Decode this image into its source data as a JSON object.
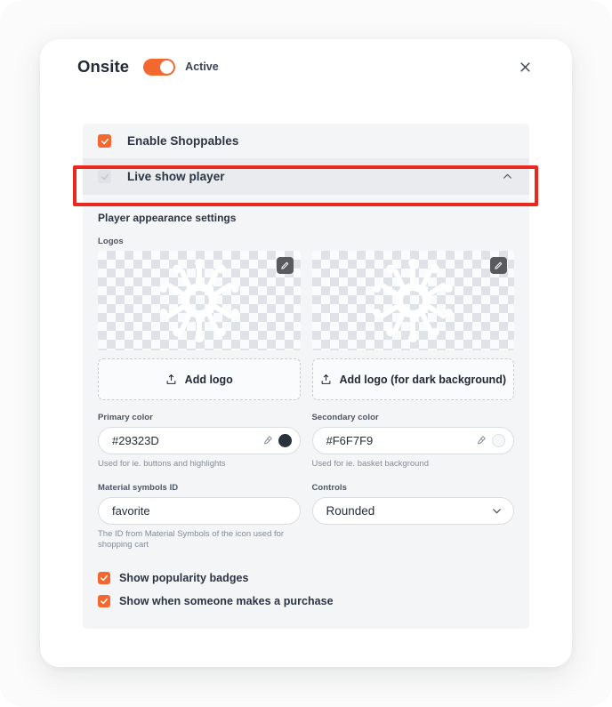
{
  "header": {
    "title": "Onsite",
    "toggle_state_label": "Active",
    "toggle_on": true,
    "close_icon": "close-icon"
  },
  "panel": {
    "rows": [
      {
        "label": "Enable Shoppables",
        "checked": true,
        "state": "on"
      },
      {
        "label": "Live show player",
        "checked": true,
        "state": "off",
        "expanded": true,
        "chevron_icon": "chevron-up-icon"
      }
    ],
    "section_title": "Player appearance settings",
    "logos_label": "Logos",
    "logos": [
      {
        "edit_icon": "pencil-icon",
        "alt": "starburst-logo"
      },
      {
        "edit_icon": "pencil-icon",
        "alt": "starburst-logo-dark"
      }
    ],
    "add_logo_buttons": [
      {
        "label": "Add logo",
        "icon": "upload-icon"
      },
      {
        "label": "Add logo (for dark background)",
        "icon": "upload-icon"
      }
    ],
    "fields": {
      "primary_color": {
        "label": "Primary color",
        "value": "#29323D",
        "help": "Used for ie. buttons and highlights",
        "swatch_hex": "#29323D",
        "picker_icon": "eyedropper-icon"
      },
      "secondary_color": {
        "label": "Secondary color",
        "value": "#F6F7F9",
        "help": "Used for ie. basket background",
        "swatch_hex": "#F6F7F9",
        "picker_icon": "eyedropper-icon"
      },
      "material_symbols_id": {
        "label": "Material symbols ID",
        "value": "favorite",
        "placeholder": "favorite",
        "help": "The ID from Material Symbols of the icon used for shopping cart"
      },
      "controls": {
        "label": "Controls",
        "value": "Rounded",
        "chevron_icon": "chevron-down-icon",
        "options": [
          "Rounded"
        ]
      }
    },
    "bottom_checks": [
      {
        "label": "Show popularity badges",
        "checked": true
      },
      {
        "label": "Show when someone makes a purchase",
        "checked": true
      }
    ]
  },
  "colors": {
    "accent_orange": "#F4682F",
    "annotation_red": "#E8291F",
    "panel_grey": "#F4F5F7",
    "row_highlight_grey": "#E9EBEE"
  }
}
